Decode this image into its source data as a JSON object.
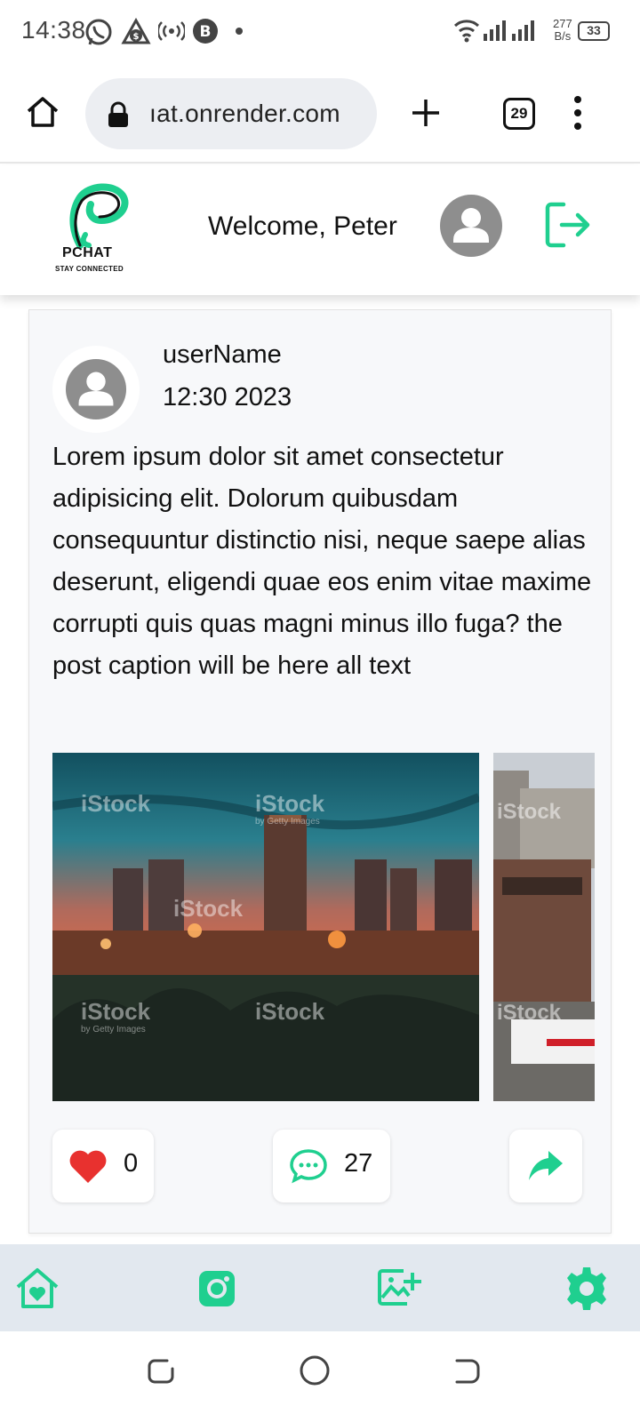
{
  "status_bar": {
    "time": "14:38",
    "net_speed_value": "277",
    "net_speed_unit": "B/s",
    "battery": "33"
  },
  "browser": {
    "url": "ıat.onrender.com",
    "tab_count": "29"
  },
  "app": {
    "brand_name": "PCHAT",
    "tagline": "STAY CONNECTED",
    "welcome": "Welcome, Peter",
    "accent_color": "#1fcf8f"
  },
  "post": {
    "author": "userName",
    "time": "12:30 2023",
    "caption": "Lorem ipsum dolor sit amet consectetur adipisicing elit. Dolorum quibusdam consequuntur distinctio nisi, neque saepe alias deserunt, eligendi quae eos enim vitae maxime corrupti quis quas magni minus illo fuga? the post caption will be here all text",
    "images": [
      {
        "watermark": "iStock",
        "watermark_sub": "by Getty Images"
      },
      {
        "watermark": "iStock",
        "watermark_sub": "by Getty Images"
      }
    ],
    "likes": "0",
    "comments": "27"
  },
  "bottom_nav": {
    "items": [
      "home-heart-icon",
      "instagram-icon",
      "add-image-icon",
      "settings-gear-icon"
    ]
  },
  "icons": [
    "whatsapp-icon",
    "app-notification-icon",
    "hotspot-icon",
    "b-app-icon",
    "dot-icon",
    "wifi-icon",
    "signal-icon",
    "battery-icon",
    "home-icon",
    "lock-icon",
    "new-tab-icon",
    "menu-dots-icon",
    "avatar-icon",
    "logout-icon",
    "heart-icon",
    "comment-icon",
    "share-icon",
    "recent-apps-icon",
    "home-circle-icon",
    "back-icon"
  ]
}
